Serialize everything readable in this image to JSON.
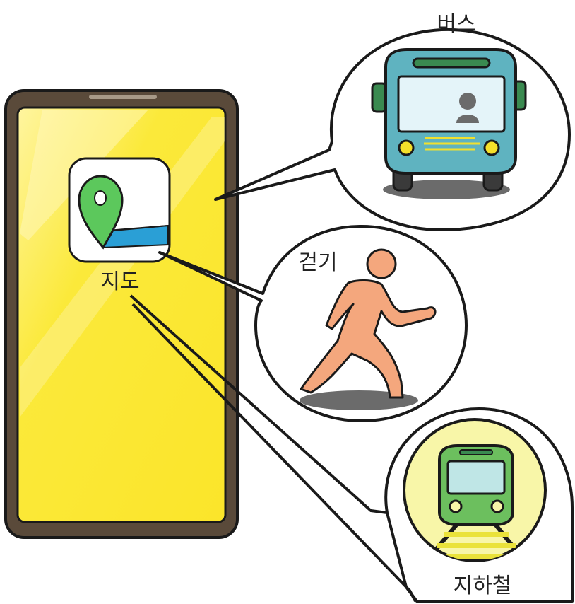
{
  "phone": {
    "app_icon": "map-pin-icon",
    "app_label": "지도"
  },
  "bubbles": [
    {
      "label": "버스",
      "icon": "bus-icon"
    },
    {
      "label": "걷기",
      "icon": "walking-person-icon"
    },
    {
      "label": "지하철",
      "icon": "subway-train-icon"
    }
  ],
  "colors": {
    "phone_frame": "#5a4a3a",
    "screen": "#fbe93a",
    "pin": "#5cc85c",
    "map_water": "#2a9fd6",
    "bus": "#5fb3c0",
    "person": "#f4a77d",
    "train": "#6cbf5e",
    "subway_bg": "#f8f6a8"
  }
}
